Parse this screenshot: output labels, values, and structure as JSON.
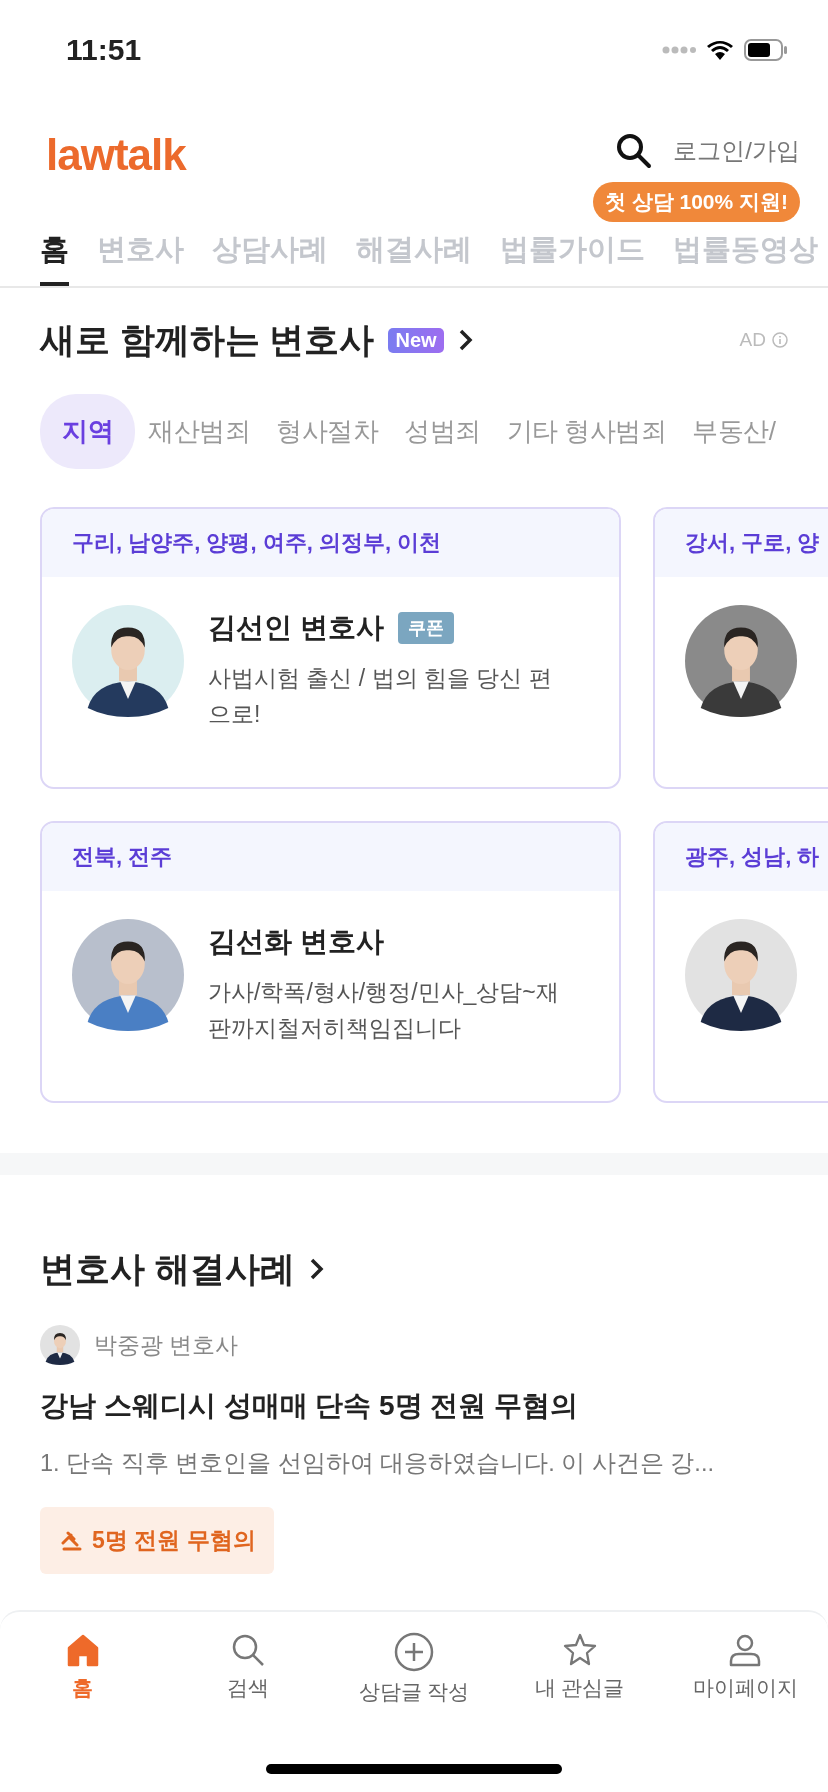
{
  "status_bar": {
    "time": "11:51"
  },
  "header": {
    "logo": "lawtalk",
    "login": "로그인/가입",
    "promo": "첫 상담 100% 지원!"
  },
  "tabs": [
    {
      "label": "홈",
      "selected": true
    },
    {
      "label": "변호사",
      "selected": false
    },
    {
      "label": "상담사례",
      "selected": false
    },
    {
      "label": "해결사례",
      "selected": false
    },
    {
      "label": "법률가이드",
      "selected": false
    },
    {
      "label": "법률동영상",
      "selected": false
    }
  ],
  "new_lawyers": {
    "title": "새로 함께하는 변호사",
    "badge": "New",
    "ad": "AD"
  },
  "chips": [
    {
      "label": "지역",
      "selected": true
    },
    {
      "label": "재산범죄",
      "selected": false
    },
    {
      "label": "형사절차",
      "selected": false
    },
    {
      "label": "성범죄",
      "selected": false
    },
    {
      "label": "기타 형사범죄",
      "selected": false
    },
    {
      "label": "부동산/",
      "selected": false
    }
  ],
  "card_rows": [
    [
      {
        "region": "구리, 남양주, 양평, 여주, 의정부, 이천",
        "name": "김선인 변호사",
        "coupon": "쿠폰",
        "description": "사법시험 출신 / 법의 힘을 당신 편으로!"
      },
      {
        "region": "강서, 구로, 양"
      }
    ],
    [
      {
        "region": "전북, 전주",
        "name": "김선화 변호사",
        "description": "가사/학폭/형사/행정/민사_상담~재판까지철저히책임집니다"
      },
      {
        "region": "광주, 성남, 하"
      }
    ]
  ],
  "solved": {
    "title": "변호사 해결사례",
    "author": "박중광 변호사",
    "case_title": "강남 스웨디시 성매매 단속 5명 전원 무혐의",
    "excerpt": "1. 단속 직후 변호인을 선임하여 대응하였습니다. 이 사건은 강...",
    "tag": "5명 전원 무혐의"
  },
  "nav": [
    {
      "label": "홈",
      "kind": "home",
      "selected": true
    },
    {
      "label": "검색",
      "kind": "search",
      "selected": false
    },
    {
      "label": "상담글 작성",
      "kind": "write",
      "selected": false
    },
    {
      "label": "내 관심글",
      "kind": "star",
      "selected": false
    },
    {
      "label": "마이페이지",
      "kind": "profile",
      "selected": false
    }
  ]
}
